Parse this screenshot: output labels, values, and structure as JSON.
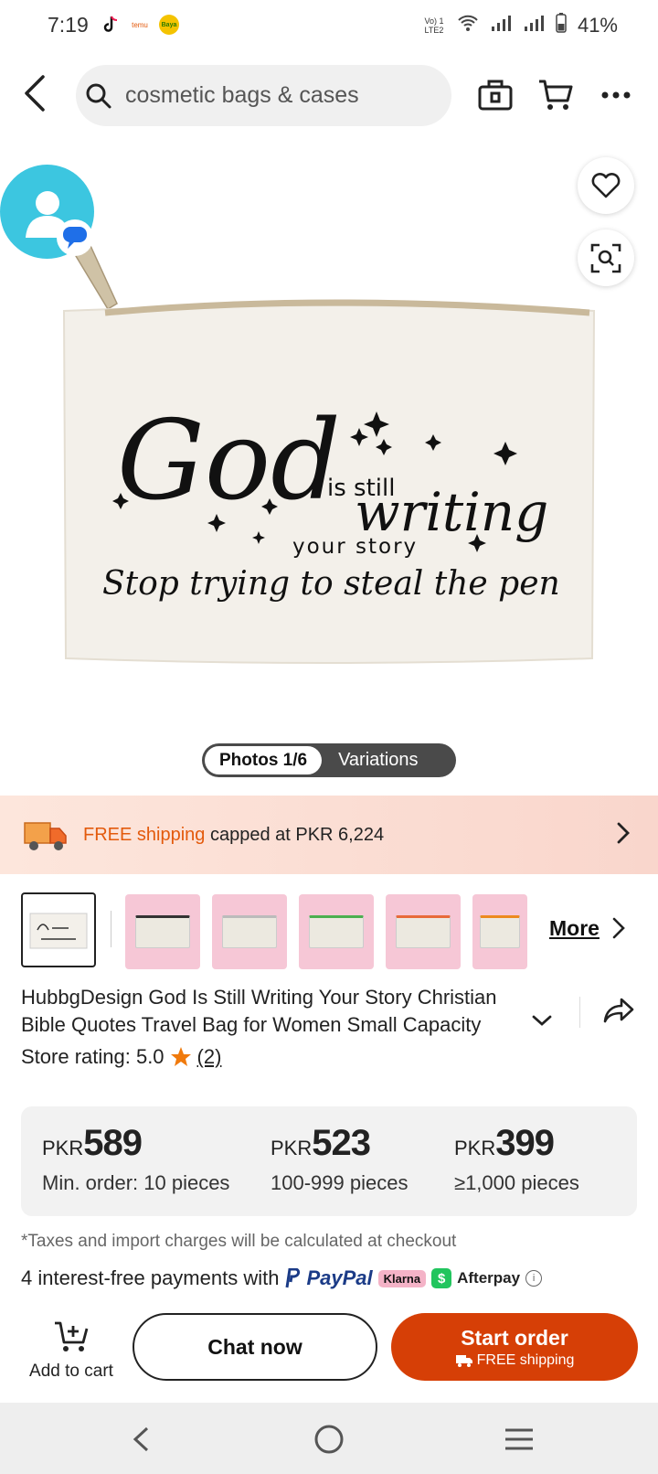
{
  "status_bar": {
    "time": "7:19",
    "app_temu": "temu",
    "app_game": "Baya",
    "network": "Vo) 1 LTE2",
    "battery": "41%"
  },
  "header": {
    "search_value": "cosmetic bags & cases"
  },
  "hero": {
    "bag_line1": "God",
    "bag_line2": "is still",
    "bag_line3": "writing",
    "bag_line4": "your story",
    "bag_line5": "Stop trying to steal the pen",
    "photos_label": "Photos 1/6",
    "variations_label": "Variations"
  },
  "shipping": {
    "highlight": "FREE shipping",
    "rest": " capped at PKR 6,224"
  },
  "thumbnails": {
    "more_label": "More"
  },
  "product": {
    "title": "HubbgDesign God Is Still Writing Your Story Christian Bible Quotes Travel Bag for Women Small Capacity",
    "rating_prefix": "Store rating: 5.0",
    "rating_count": "(2)"
  },
  "prices": [
    {
      "currency": "PKR",
      "amount": "589",
      "qty": "Min. order: 10 pieces"
    },
    {
      "currency": "PKR",
      "amount": "523",
      "qty": "100-999 pieces"
    },
    {
      "currency": "PKR",
      "amount": "399",
      "qty": "≥1,000 pieces"
    }
  ],
  "tax_note": "*Taxes and import charges will be calculated at checkout",
  "payments": {
    "text": "4 interest-free payments with",
    "paypal": "PayPal",
    "klarna": "Klarna",
    "afterpay_badge": "$",
    "afterpay": "Afterpay"
  },
  "actions": {
    "add_to_cart": "Add to cart",
    "chat_now": "Chat now",
    "start_order": "Start order",
    "free_shipping": "FREE shipping"
  },
  "colors": {
    "accent": "#d63f06",
    "shipping_highlight": "#e35a0c",
    "avatar_bubble": "#3cc6e0"
  }
}
